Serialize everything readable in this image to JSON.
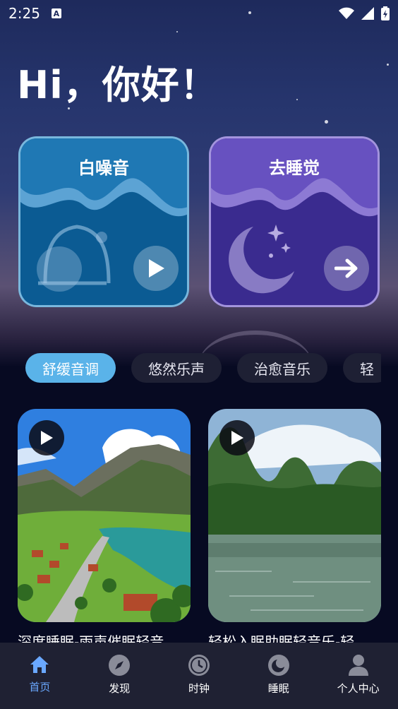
{
  "status": {
    "time": "2:25"
  },
  "greeting": "Hi，你好！",
  "cards": {
    "white_noise": {
      "title": "白噪音",
      "icon": "bell-icon",
      "action_icon": "play-icon"
    },
    "sleep": {
      "title": "去睡觉",
      "icon": "moon-icon",
      "action_icon": "arrow-right-icon"
    }
  },
  "chips": [
    "舒缓音调",
    "悠然乐声",
    "治愈音乐",
    "轻"
  ],
  "tracks": [
    {
      "title": "深度睡眠-雨声催眠轻音"
    },
    {
      "title": "轻松入眠助眠轻音乐-轻"
    }
  ],
  "tabs": [
    {
      "label": "首页",
      "icon": "home-icon"
    },
    {
      "label": "发现",
      "icon": "compass-icon"
    },
    {
      "label": "时钟",
      "icon": "clock-icon"
    },
    {
      "label": "睡眠",
      "icon": "sleep-icon"
    },
    {
      "label": "个人中心",
      "icon": "user-icon"
    }
  ],
  "colors": {
    "accent": "#5ab3e9",
    "tab_active": "#6aa8ff",
    "card_blue": "#0f5a8f",
    "card_purple": "#3b2a8e"
  }
}
